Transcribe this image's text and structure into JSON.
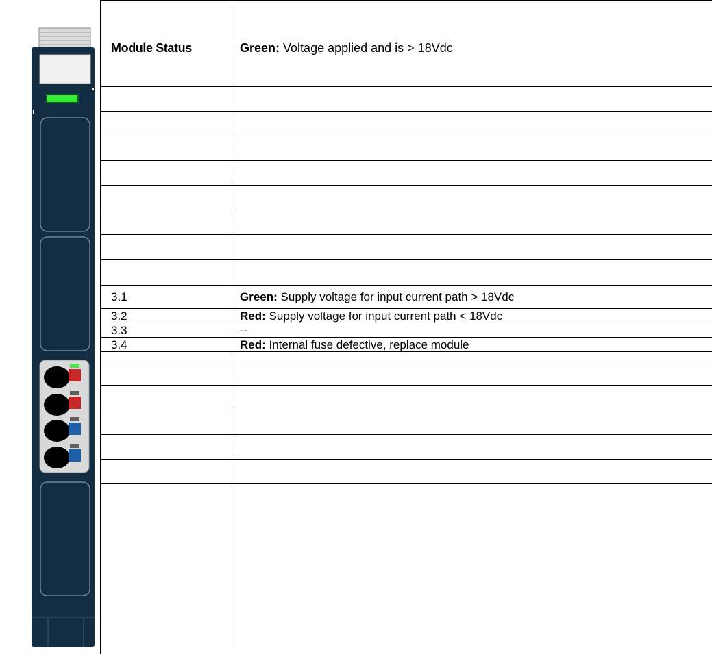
{
  "header": {
    "left": "Module Status",
    "right_label": "Green:",
    "right_text": " Voltage applied and is > 18Vdc"
  },
  "rows": [
    {
      "id": "3.1",
      "status_label": "Green:",
      "status_text": " Supply voltage for input current path > 18Vdc"
    },
    {
      "id": "3.2",
      "status_label": "Red:",
      "status_text": " Supply voltage for input current path < 18Vdc"
    },
    {
      "id": "3.3",
      "status_label": "",
      "status_text": "--"
    },
    {
      "id": "3.4",
      "status_label": "Red:",
      "status_text": " Internal fuse defective, replace module"
    }
  ],
  "colors": {
    "module_body": "#132d43",
    "module_outline": "#6d8797",
    "led_green": "#33ee33",
    "led_red": "#c62828",
    "led_blue": "#1f5fa8",
    "connector_panel": "#d9d9d9",
    "label_area": "#f0f0f0"
  },
  "icons": {
    "module": "io-module-illustration",
    "status_led": "green-led"
  }
}
